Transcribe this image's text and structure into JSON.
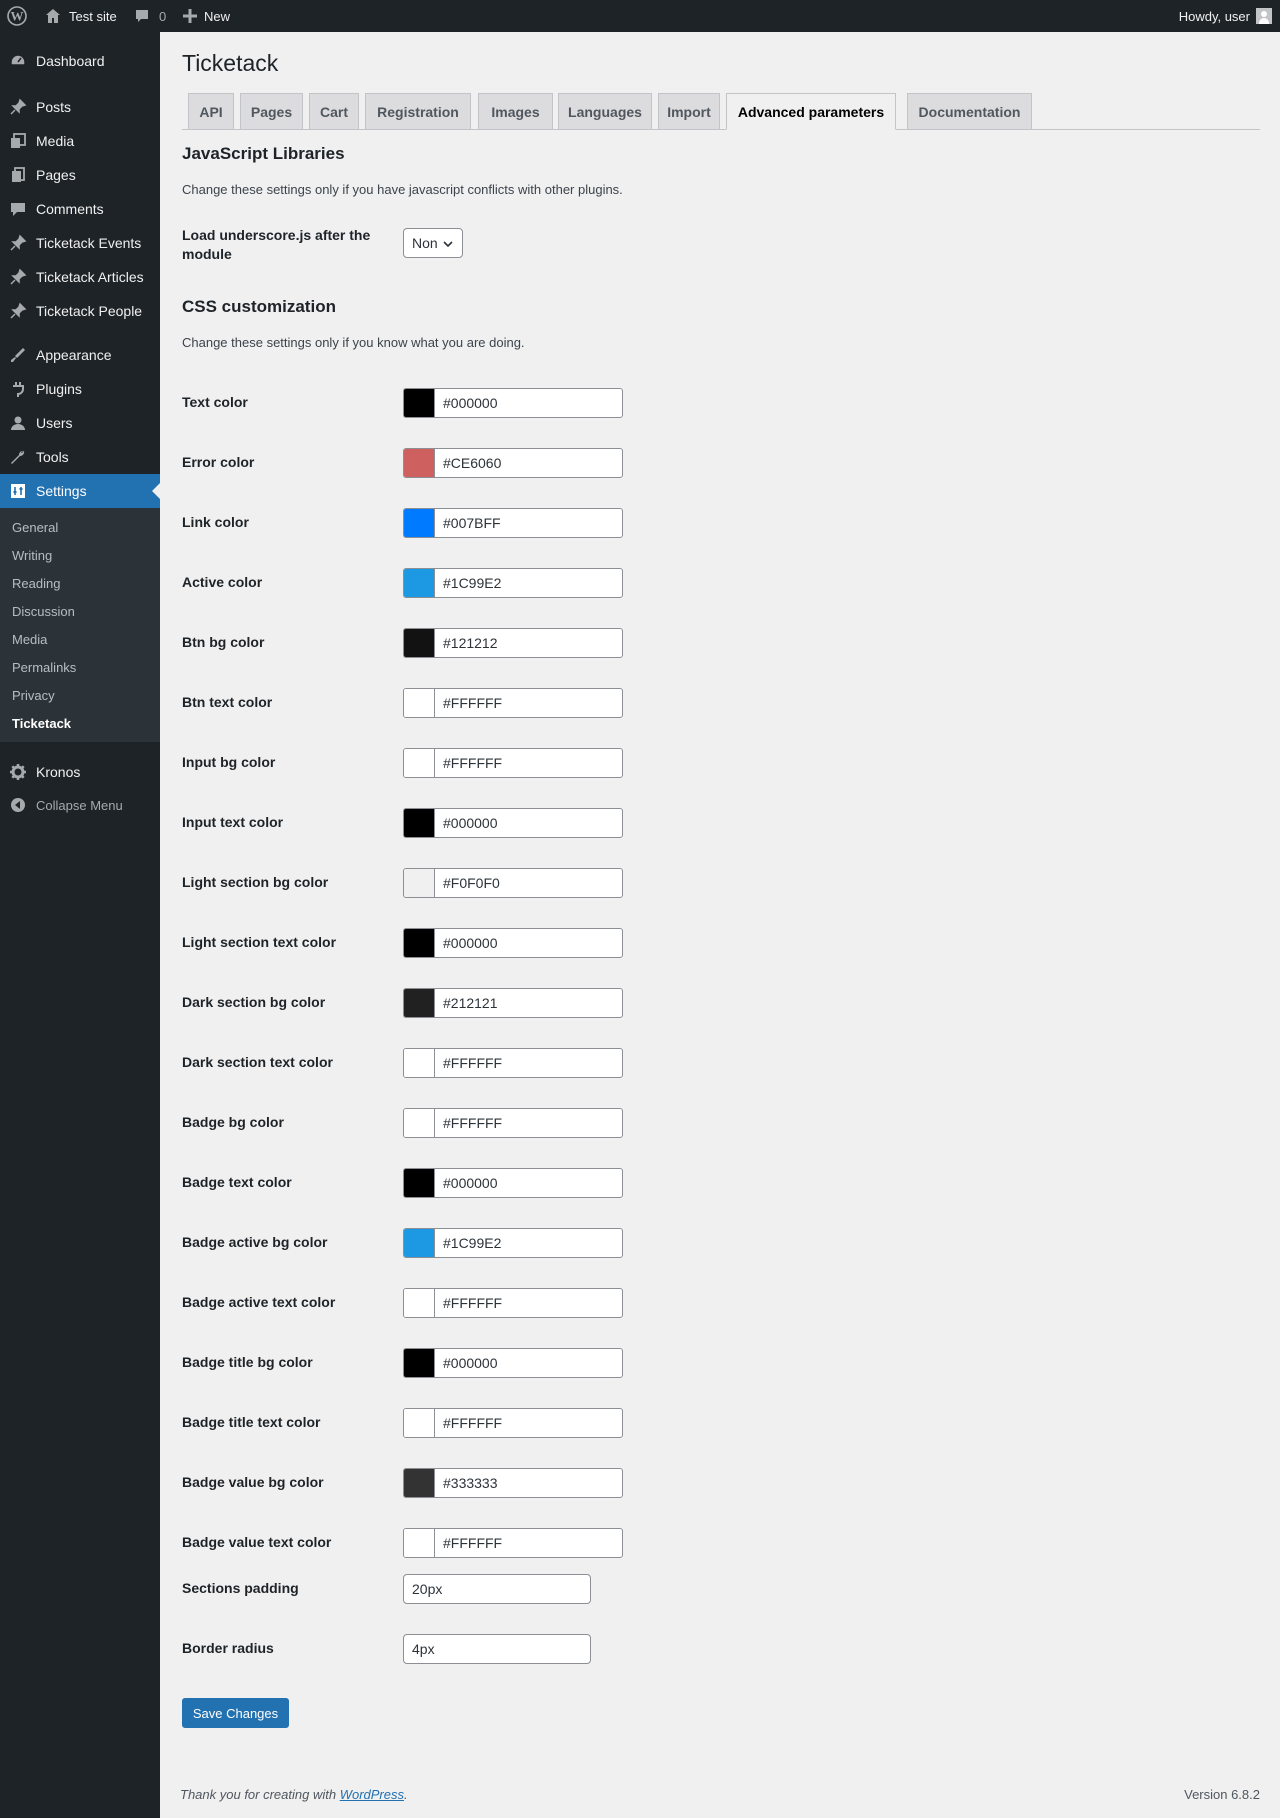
{
  "adminbar": {
    "site_name": "Test site",
    "comments_count": "0",
    "new_label": "New",
    "howdy": "Howdy, user"
  },
  "sidebar": {
    "items": [
      {
        "label": "Dashboard",
        "icon": "dashboard-icon"
      },
      {
        "label": "Posts",
        "icon": "pin-icon"
      },
      {
        "label": "Media",
        "icon": "media-icon"
      },
      {
        "label": "Pages",
        "icon": "pages-icon"
      },
      {
        "label": "Comments",
        "icon": "comments-icon"
      },
      {
        "label": "Ticketack Events",
        "icon": "pin-icon"
      },
      {
        "label": "Ticketack Articles",
        "icon": "pin-icon"
      },
      {
        "label": "Ticketack People",
        "icon": "pin-icon"
      },
      {
        "label": "Appearance",
        "icon": "appearance-icon"
      },
      {
        "label": "Plugins",
        "icon": "plugins-icon"
      },
      {
        "label": "Users",
        "icon": "users-icon"
      },
      {
        "label": "Tools",
        "icon": "tools-icon"
      },
      {
        "label": "Settings",
        "icon": "settings-icon"
      },
      {
        "label": "Kronos",
        "icon": "gear-icon"
      }
    ],
    "submenu": [
      "General",
      "Writing",
      "Reading",
      "Discussion",
      "Media",
      "Permalinks",
      "Privacy",
      "Ticketack"
    ],
    "collapse_label": "Collapse Menu"
  },
  "page": {
    "title": "Ticketack",
    "tabs": [
      "API",
      "Pages",
      "Cart",
      "Registration",
      "Images",
      "Languages",
      "Import",
      "Advanced parameters",
      "Documentation"
    ],
    "active_tab": "Advanced parameters"
  },
  "js_section": {
    "heading": "JavaScript Libraries",
    "description": "Change these settings only if you have javascript conflicts with other plugins.",
    "underscore_label": "Load underscore.js after the module",
    "underscore_value": "Non"
  },
  "css_section": {
    "heading": "CSS customization",
    "description": "Change these settings only if you know what you are doing.",
    "colors": [
      {
        "label": "Text color",
        "value": "#000000"
      },
      {
        "label": "Error color",
        "value": "#CE6060"
      },
      {
        "label": "Link color",
        "value": "#007BFF"
      },
      {
        "label": "Active color",
        "value": "#1C99E2"
      },
      {
        "label": "Btn bg color",
        "value": "#121212"
      },
      {
        "label": "Btn text color",
        "value": "#FFFFFF"
      },
      {
        "label": "Input bg color",
        "value": "#FFFFFF"
      },
      {
        "label": "Input text color",
        "value": "#000000"
      },
      {
        "label": "Light section bg color",
        "value": "#F0F0F0"
      },
      {
        "label": "Light section text color",
        "value": "#000000"
      },
      {
        "label": "Dark section bg color",
        "value": "#212121"
      },
      {
        "label": "Dark section text color",
        "value": "#FFFFFF"
      },
      {
        "label": "Badge bg color",
        "value": "#FFFFFF"
      },
      {
        "label": "Badge text color",
        "value": "#000000"
      },
      {
        "label": "Badge active bg color",
        "value": "#1C99E2"
      },
      {
        "label": "Badge active text color",
        "value": "#FFFFFF"
      },
      {
        "label": "Badge title bg color",
        "value": "#000000"
      },
      {
        "label": "Badge title text color",
        "value": "#FFFFFF"
      },
      {
        "label": "Badge value bg color",
        "value": "#333333"
      },
      {
        "label": "Badge value text color",
        "value": "#FFFFFF"
      }
    ],
    "sections_padding_label": "Sections padding",
    "sections_padding_value": "20px",
    "border_radius_label": "Border radius",
    "border_radius_value": "4px"
  },
  "save_label": "Save Changes",
  "footer": {
    "thanks_prefix": "Thank you for creating with ",
    "thanks_link": "WordPress",
    "thanks_suffix": ".",
    "version": "Version 6.8.2"
  },
  "colors": {
    "admin_bg": "#1d2327",
    "accent": "#2271b1",
    "page_bg": "#f0f0f1"
  }
}
